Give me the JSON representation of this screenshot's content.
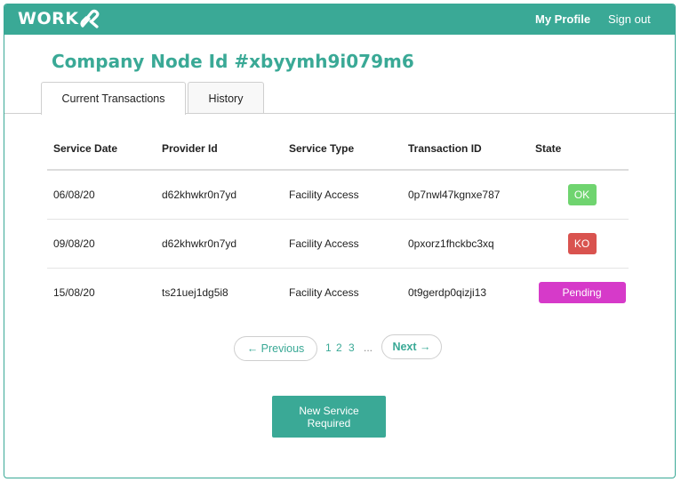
{
  "header": {
    "logo_text": "WORK",
    "logo_icon": "chain-link-k-icon",
    "nav": {
      "my_profile": "My Profile",
      "sign_out": "Sign out"
    }
  },
  "page": {
    "title": "Company Node Id #xbyymh9i079m6"
  },
  "tabs": [
    {
      "label": "Current Transactions",
      "active": true
    },
    {
      "label": "History",
      "active": false
    }
  ],
  "table": {
    "headers": [
      "Service Date",
      "Provider Id",
      "Service Type",
      "Transaction ID",
      "State"
    ],
    "rows": [
      {
        "date": "06/08/20",
        "provider": "d62khwkr0n7yd",
        "type": "Facility Access",
        "txid": "0p7nwl47kgnxe787",
        "state": "OK"
      },
      {
        "date": "09/08/20",
        "provider": "d62khwkr0n7yd",
        "type": "Facility Access",
        "txid": "0pxorz1fhckbc3xq",
        "state": "KO"
      },
      {
        "date": "15/08/20",
        "provider": "ts21uej1dg5i8",
        "type": "Facility Access",
        "txid": "0t9gerdp0qizji13",
        "state": "Pending"
      }
    ]
  },
  "pagination": {
    "previous": "← Previous",
    "pages": [
      "1",
      "2",
      "3"
    ],
    "ellipsis": "...",
    "next": "Next →"
  },
  "actions": {
    "new_service": "New Service Required"
  },
  "colors": {
    "brand": "#3aa996",
    "ok": "#6fd46f",
    "ko": "#d9534f",
    "pending": "#d63ac9"
  }
}
